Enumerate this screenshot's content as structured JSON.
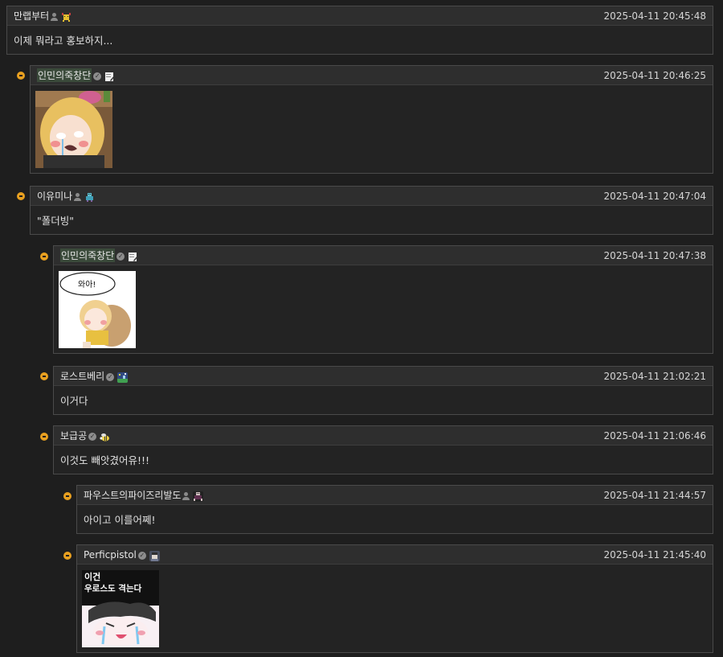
{
  "comments": [
    {
      "author": "만랩부터",
      "author_badge": "user-icon",
      "level_icon": "yellow-creature-badge-icon",
      "date": "2025-04-11 20:45:48",
      "text": "이제 뭐라고 홍보하지..."
    },
    {
      "author": "인민의죽창단",
      "author_badge": "verified-icon",
      "level_icon": "pen-note-badge-icon",
      "date": "2025-04-11 20:46:25",
      "image": "sticker-blonde-girl-crying"
    },
    {
      "author": "이유미나",
      "author_badge": "user-icon",
      "level_icon": "teal-robot-badge-icon",
      "date": "2025-04-11 20:47:04",
      "text": "\"폴더빙\""
    },
    {
      "author": "인민의죽창단",
      "author_badge": "verified-icon",
      "level_icon": "pen-note-badge-icon",
      "date": "2025-04-11 20:47:38",
      "image": "sticker-girl-hugging-dog",
      "image_text": "와아!"
    },
    {
      "author": "로스트베리",
      "author_badge": "verified-icon",
      "level_icon": "pixel-landscape-badge-icon",
      "date": "2025-04-11 21:02:21",
      "text": "이거다"
    },
    {
      "author": "보급공",
      "author_badge": "verified-icon",
      "level_icon": "bee-badge-icon",
      "date": "2025-04-11 21:06:46",
      "text": "이것도 빼앗겼어유!!!"
    },
    {
      "author": "파우스트의파이즈리발도",
      "author_badge": "user-icon",
      "level_icon": "dark-character-badge-icon",
      "date": "2025-04-11 21:44:57",
      "text": "아이고 이를어쩨!"
    },
    {
      "author": "Perficpistol",
      "author_badge": "verified-icon",
      "level_icon": "portrait-badge-icon",
      "date": "2025-04-11 21:45:40",
      "image": "sticker-crying-face-meme",
      "image_text_line1": "이건",
      "image_text_line2": "우로스도 격는다"
    }
  ]
}
